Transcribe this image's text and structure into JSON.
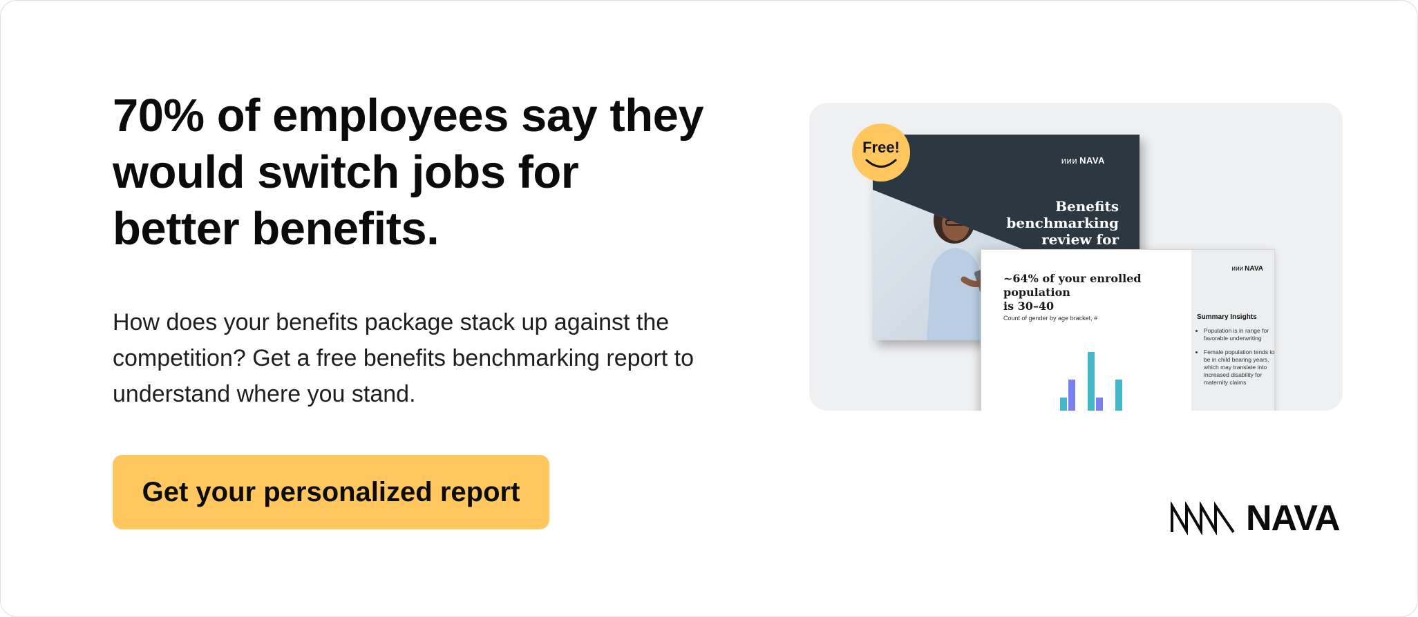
{
  "headline": {
    "lines": [
      "70% of employees say they",
      "would switch jobs for",
      "better benefits."
    ]
  },
  "body": {
    "lines": [
      "How does your benefits package stack up against the",
      "competition? Get a free benefits benchmarking report to",
      "understand where you stand."
    ]
  },
  "cta": {
    "label": "Get your personalized report"
  },
  "preview": {
    "badge": "Free!",
    "cover": {
      "logo": "NAVA",
      "title_lines": [
        "Benefits",
        "benchmarking",
        "review for"
      ]
    },
    "report": {
      "logo": "NAVA",
      "title_lines": [
        "~64% of your enrolled population",
        "is 30–40"
      ],
      "chart_caption": "Count of gender by age bracket, #",
      "side_title": "Summary Insights",
      "insights": [
        "Population is in range for favorable underwriting",
        "Female population tends to be in child bearing years, which may translate into increased disability for maternity claims"
      ]
    }
  },
  "brand": {
    "name": "NAVA",
    "icon": "nava-zigzag-icon"
  },
  "colors": {
    "accent": "#ffc75e",
    "cover": "#2c3841",
    "teal": "#45b7c8",
    "violet": "#7b80ef",
    "panel": "#eff0f2"
  }
}
